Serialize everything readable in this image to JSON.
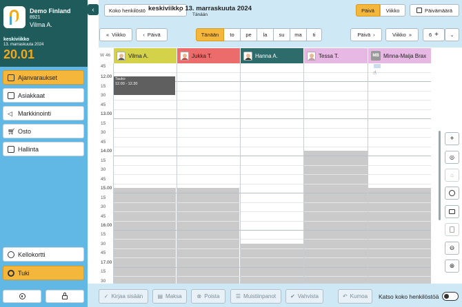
{
  "sidebar": {
    "company_name": "Demo Finland",
    "company_number": "8921",
    "user_name": "Vilma A.",
    "weekday": "keskiviikko",
    "full_date": "13. marraskuuta 2024",
    "clock": "20.01",
    "nav": [
      {
        "label": "Ajanvaraukset",
        "icon": "calendar-icon",
        "active": true
      },
      {
        "label": "Asiakkaat",
        "icon": "customers-icon",
        "active": false
      },
      {
        "label": "Markkinointi",
        "icon": "megaphone-icon",
        "active": false
      },
      {
        "label": "Osto",
        "icon": "cart-icon",
        "active": false
      },
      {
        "label": "Hallinta",
        "icon": "briefcase-icon",
        "active": false
      }
    ],
    "timecard_label": "Kellokortti",
    "support_label": "Tuki"
  },
  "topbar": {
    "staff_select": "Koko henkilöstö",
    "date_title": "keskiviikko 13. marraskuuta 2024",
    "date_subtitle": "Tänään",
    "view_day": "Päivä",
    "view_week": "Viikko",
    "calendar_btn": "Päivämäärä"
  },
  "navbar": {
    "prev_week": "Viikko",
    "prev_day": "Päivä",
    "days": [
      "Tänään",
      "to",
      "pe",
      "la",
      "su",
      "ma",
      "ti"
    ],
    "next_day": "Päivä",
    "next_week": "Viikko",
    "columns_count": "6"
  },
  "calendar": {
    "week_label": "W 46",
    "columns": [
      {
        "name": "Vilma A.",
        "color": "#d4d248"
      },
      {
        "name": "Jukka T.",
        "color": "#ec6b6b"
      },
      {
        "name": "Hanna A.",
        "color": "#2e6b6b"
      },
      {
        "name": "Tessa T.",
        "color": "#e8b8e4"
      },
      {
        "name": "Minna-Maija Brax",
        "color": "#e8b8e4",
        "initials": "MB"
      }
    ],
    "time_rows": [
      "45",
      "12.00",
      "15",
      "30",
      "45",
      "13.00",
      "15",
      "30",
      "45",
      "14.00",
      "15",
      "30",
      "45",
      "15.00",
      "15",
      "30",
      "45",
      "16.00",
      "15",
      "30",
      "45",
      "17.00",
      "15",
      "30"
    ],
    "event": {
      "title": "Tauko",
      "time": "12.00 - 12.30"
    }
  },
  "bottombar": {
    "checkin": "Kirjaa sisään",
    "pay": "Maksa",
    "delete": "Poista",
    "notes": "Muistiinpanot",
    "confirm": "Vahvista",
    "undo": "Kumoa",
    "show_all_label": "Katso koko henkilöstöä"
  }
}
